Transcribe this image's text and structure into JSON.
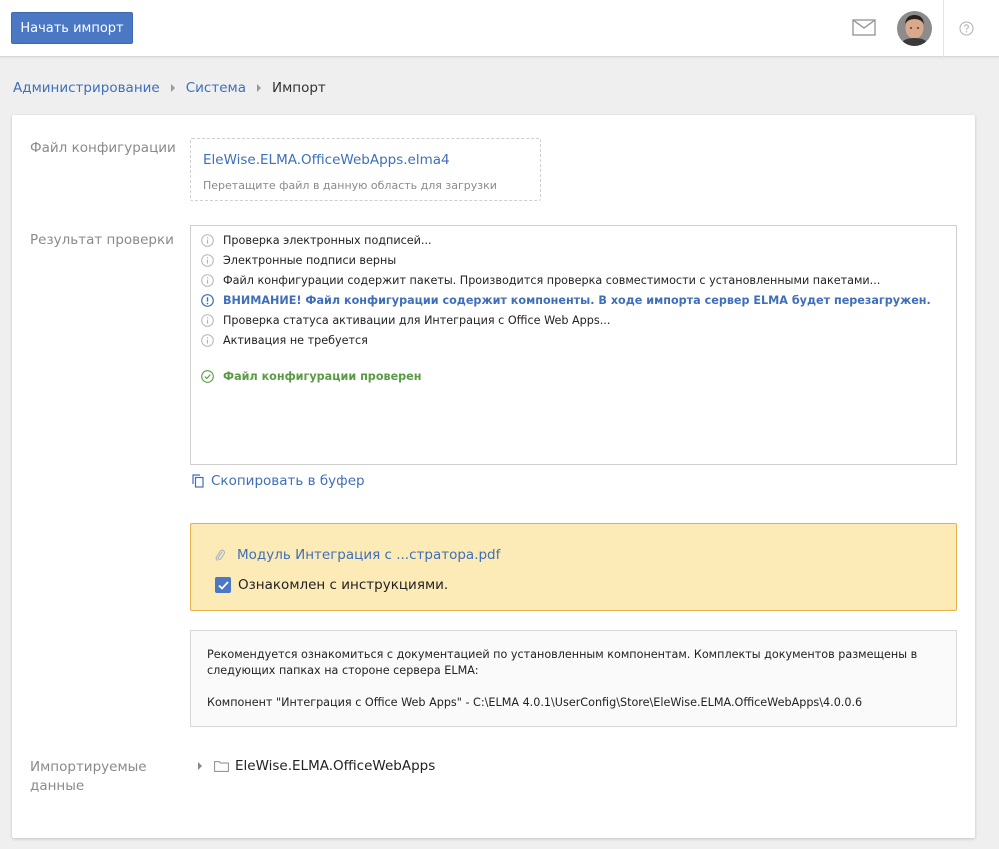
{
  "toolbar": {
    "start_import_label": "Начать импорт"
  },
  "header_icons": [
    "mail-icon",
    "avatar",
    "help-icon"
  ],
  "breadcrumb": [
    "Администрирование",
    "Система",
    "Импорт"
  ],
  "form": {
    "config_file_label": "Файл конфигурации",
    "config_file_name": "EleWise.ELMA.OfficeWebApps.elma4",
    "dropzone_hint": "Перетащите файл в данную область для загрузки",
    "check_result_label": "Результат проверки",
    "log": [
      {
        "type": "info",
        "text": "Проверка электронных подписей..."
      },
      {
        "type": "info",
        "text": "Электронные подписи верны"
      },
      {
        "type": "info",
        "text": "Файл конфигурации содержит пакеты. Производится проверка совместимости с установленными пакетами..."
      },
      {
        "type": "warning",
        "text": "ВНИМАНИЕ! Файл конфигурации содержит компоненты. В ходе импорта сервер ELMA будет перезагружен."
      },
      {
        "type": "info",
        "text": "Проверка статуса активации для Интеграция с Office Web Apps..."
      },
      {
        "type": "info",
        "text": "Активация не требуется"
      },
      {
        "type": "success",
        "text": "Файл конфигурации проверен"
      }
    ],
    "copy_label": "Скопировать в буфер",
    "attachment_name": "Модуль Интеграция с ...стратора.pdf",
    "acknowledged_label": "Ознакомлен с инструкциями.",
    "acknowledged": true,
    "doc_text_1": "Рекомендуется ознакомиться с документацией по установленным компонентам. Комплекты документов размещены в следующих папках на стороне сервера ELMA:",
    "doc_text_2": "Компонент \"Интеграция с Office Web Apps\" - C:\\ELMA 4.0.1\\UserConfig\\Store\\EleWise.ELMA.OfficeWebApps\\4.0.0.6",
    "imported_label": "Импортируемые данные",
    "tree_item": "EleWise.ELMA.OfficeWebApps"
  },
  "colors": {
    "accent": "#4a78c4",
    "link": "#3f6fb8",
    "success": "#5a9c45",
    "notice_bg": "#fdebb7",
    "notice_border": "#e6b24e"
  }
}
